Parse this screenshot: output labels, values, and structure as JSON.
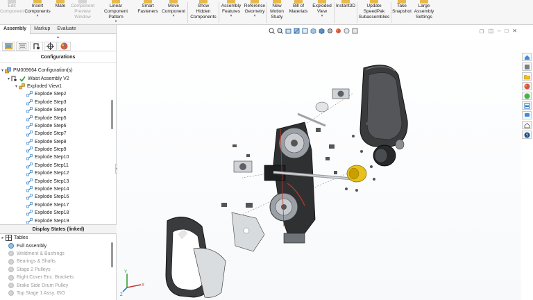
{
  "ribbon": [
    {
      "label": "Edit\nComponent",
      "disabled": true,
      "arrow": false
    },
    {
      "label": "Insert\nComponents",
      "disabled": false,
      "arrow": true
    },
    {
      "label": "Mate",
      "disabled": false,
      "arrow": false
    },
    {
      "label": "Component\nPreview\nWindow",
      "disabled": true,
      "arrow": false
    },
    {
      "label": "Linear Component\nPattern",
      "disabled": false,
      "arrow": true
    },
    {
      "label": "Smart\nFasteners",
      "disabled": false,
      "arrow": false
    },
    {
      "label": "Move\nComponent",
      "disabled": false,
      "arrow": true
    },
    {
      "label": "Show\nHidden\nComponents",
      "disabled": false,
      "arrow": false
    },
    {
      "label": "Assembly\nFeatures",
      "disabled": false,
      "arrow": true
    },
    {
      "label": "Reference\nGeometry",
      "disabled": false,
      "arrow": true
    },
    {
      "label": "New\nMotion\nStudy",
      "disabled": false,
      "arrow": false
    },
    {
      "label": "Bill of\nMaterials",
      "disabled": false,
      "arrow": false
    },
    {
      "label": "Exploded\nView",
      "disabled": false,
      "arrow": true
    },
    {
      "label": "Instant3D",
      "disabled": false,
      "arrow": false
    },
    {
      "label": "Update\nSpeedPak\nSubassemblies",
      "disabled": false,
      "arrow": false
    },
    {
      "label": "Take\nSnapshot",
      "disabled": false,
      "arrow": false
    },
    {
      "label": "Large\nAssembly\nSettings",
      "disabled": false,
      "arrow": false
    }
  ],
  "tabs": [
    "Assembly",
    "Markup",
    "Evaluate"
  ],
  "panel": {
    "section_title": "Configurations",
    "display_states_title": "Display States (linked)"
  },
  "tree": {
    "root": "PM009664 Configuration(s)",
    "config": "Waist Assembly V2",
    "exploded_view": "Exploded View1",
    "steps": [
      "Explode Step2",
      "Explode Step3",
      "Explode Step4",
      "Explode Step5",
      "Explode Step6",
      "Explode Step7",
      "Explode Step8",
      "Explode Step9",
      "Explode Step10",
      "Explode Step11",
      "Explode Step12",
      "Explode Step13",
      "Explode Step14",
      "Explode Step16",
      "Explode Step17",
      "Explode Step18",
      "Explode Step19"
    ]
  },
  "display_states": {
    "tables": "Tables",
    "items": [
      {
        "label": "Full Assembly",
        "active": true
      },
      {
        "label": "Weldment & Bushings",
        "active": false
      },
      {
        "label": "Bearings & Shafts",
        "active": false
      },
      {
        "label": "Stage 2 Pulleys",
        "active": false
      },
      {
        "label": "Right Cover Enc. Brackets",
        "active": false
      },
      {
        "label": "Brake Side Drum Pulley",
        "active": false
      },
      {
        "label": "Top Stage 1 Assy. ISO",
        "active": false
      }
    ]
  },
  "triad": {
    "x": "X",
    "y": "Y",
    "z": "Z"
  },
  "colors": {
    "accent": "#1f6fbf",
    "yellow_part": "#e8c21c",
    "gear_gray": "#9aa0a6",
    "housing_dark": "#3a3b3d"
  }
}
